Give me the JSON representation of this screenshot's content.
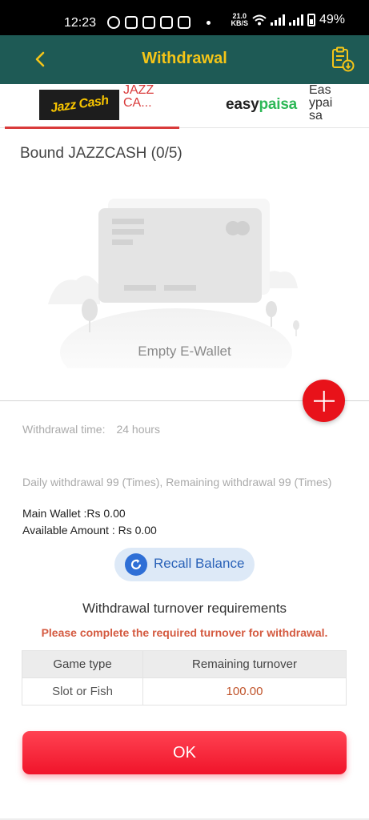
{
  "status_bar": {
    "time": "12:23",
    "net_speed_value": "21.0",
    "net_speed_unit": "KB/S",
    "battery": "49%"
  },
  "header": {
    "title": "Withdrawal",
    "back_icon": "chevron-left-icon",
    "records_icon": "clipboard-download-icon"
  },
  "tabs": [
    {
      "logo": "Jazz Cash",
      "label": "JAZZCA...",
      "active": true
    },
    {
      "logo_prefix": "easy",
      "logo_suffix": "paisa",
      "label": "Easypaisa",
      "active": false
    }
  ],
  "bound_title": "Bound JAZZCASH (0/5)",
  "empty_wallet_text": "Empty E-Wallet",
  "info": {
    "withdrawal_time_label": "Withdrawal time:",
    "withdrawal_time_value": "24 hours",
    "daily_limit": "Daily withdrawal 99 (Times), Remaining withdrawal 99 (Times)",
    "main_wallet": "Main Wallet :Rs 0.00",
    "available_amount": "Available Amount : Rs 0.00"
  },
  "recall_button": {
    "label": "Recall Balance"
  },
  "turnover": {
    "title": "Withdrawal turnover requirements",
    "warning": "Please complete the required turnover for withdrawal.",
    "columns": [
      "Game type",
      "Remaining turnover"
    ],
    "rows": [
      {
        "game_type": "Slot or Fish",
        "remaining": "100.00"
      }
    ]
  },
  "ok_button": {
    "label": "OK"
  },
  "colors": {
    "header_bg": "#1e5a55",
    "title": "#f5c518",
    "accent_red": "#e8121a",
    "recall_blue": "#2f6fd6"
  }
}
